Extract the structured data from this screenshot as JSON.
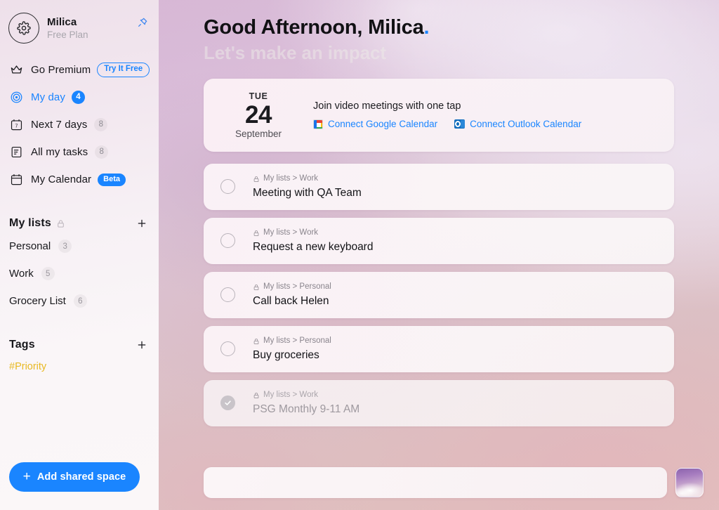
{
  "sidebar": {
    "profile": {
      "name": "Milica",
      "plan": "Free Plan",
      "avatar_icon": "gear-icon",
      "pin_icon": "pin-icon"
    },
    "nav": [
      {
        "label": "Go Premium",
        "icon": "crown-icon",
        "pill": "Try It Free",
        "badge": null,
        "active": false
      },
      {
        "label": "My day",
        "icon": "target-icon",
        "pill": null,
        "badge": "4",
        "badge_type": "blue",
        "active": true
      },
      {
        "label": "Next 7 days",
        "icon": "calendar-7-icon",
        "pill": null,
        "badge": "8",
        "badge_type": "grey",
        "active": false
      },
      {
        "label": "All my tasks",
        "icon": "list-icon",
        "pill": null,
        "badge": "8",
        "badge_type": "grey",
        "active": false
      },
      {
        "label": "My Calendar",
        "icon": "calendar-icon",
        "pill": null,
        "badge": "Beta",
        "badge_type": "beta",
        "active": false
      }
    ],
    "my_lists": {
      "title": "My lists",
      "lock_icon": "lock-icon",
      "add_icon": "plus-icon",
      "items": [
        {
          "name": "Personal",
          "count": "3"
        },
        {
          "name": "Work",
          "count": "5"
        },
        {
          "name": "Grocery List",
          "count": "6"
        }
      ]
    },
    "tags": {
      "title": "Tags",
      "add_icon": "plus-icon",
      "items": [
        {
          "name": "#Priority",
          "color": "#e8b923"
        }
      ]
    },
    "add_shared_space": "Add shared space"
  },
  "main": {
    "greeting": "Good Afternoon, Milica",
    "greeting_dot": ".",
    "subgreeting": "Let's make an impact",
    "calendar_card": {
      "day_of_week": "TUE",
      "day": "24",
      "month": "September",
      "title": "Join video meetings with one tap",
      "links": [
        {
          "label": "Connect Google Calendar",
          "icon": "google-calendar-icon"
        },
        {
          "label": "Connect Outlook Calendar",
          "icon": "outlook-calendar-icon"
        }
      ]
    },
    "tasks": [
      {
        "path": "My lists > Work",
        "title": "Meeting with QA Team",
        "done": false
      },
      {
        "path": "My lists > Work",
        "title": "Request a new keyboard",
        "done": false
      },
      {
        "path": "My lists > Personal",
        "title": "Call back Helen",
        "done": false
      },
      {
        "path": "My lists > Personal",
        "title": "Buy groceries",
        "done": false
      },
      {
        "path": "My lists > Work",
        "title": "PSG Monthly 9-11 AM",
        "done": true
      }
    ],
    "add_task_placeholder": "",
    "add_task_value": "",
    "theme_thumb_icon": "theme-thumbnail"
  },
  "colors": {
    "accent": "#1a85ff",
    "tag": "#e8b923",
    "text": "#16161a",
    "muted": "#8a858d"
  }
}
